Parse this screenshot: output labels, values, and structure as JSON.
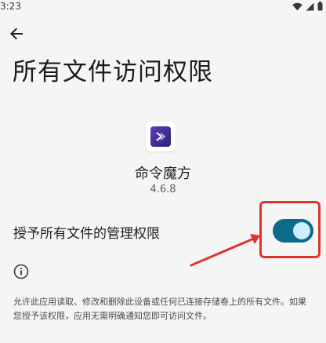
{
  "status_bar": {
    "time": "3:23",
    "icons": [
      "wifi-icon",
      "signal-icon",
      "battery-icon"
    ]
  },
  "header": {
    "back_icon": "arrow-back-icon",
    "title": "所有文件访问权限"
  },
  "app": {
    "icon": "app-icon",
    "name": "命令魔方",
    "version": "4.6.8"
  },
  "permission": {
    "label": "授予所有文件的管理权限",
    "enabled": true
  },
  "info": {
    "icon": "info-icon",
    "description": "允许此应用读取、修改和删除此设备或任何已连接存储卷上的所有文件。如果您授予该权限，应用无需明确通知您即可访问文件。"
  },
  "colors": {
    "background": "#f5f5f5",
    "toggle_track": "#0e6a8a",
    "toggle_thumb": "#cfeeff",
    "annotation": "#e0332b",
    "app_icon_bg": "#5a3fb8"
  }
}
